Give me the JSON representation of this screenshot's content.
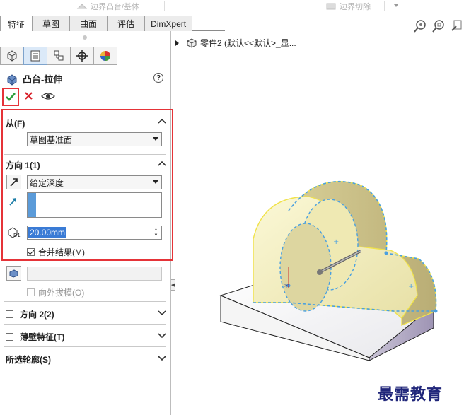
{
  "toolbar": {
    "boss_label": "边界凸台/基体",
    "cut_label": "边界切除"
  },
  "tabs": [
    "特征",
    "草图",
    "曲面",
    "评估",
    "DimXpert"
  ],
  "panel": {
    "icons": [
      "feature-manager-icon",
      "property-manager-icon",
      "configuration-manager-icon",
      "dimxpert-manager-icon",
      "display-manager-icon"
    ],
    "feature_title": "凸台-拉伸",
    "help_glyph": "?",
    "from": {
      "label": "从(F)",
      "value": "草图基准面"
    },
    "direction1": {
      "label": "方向 1(1)",
      "end_condition": "给定深度",
      "depth": "20.00mm",
      "merge_label": "合并结果(M)",
      "merge_checked": true,
      "draft_outward_label": "向外拔模(O)"
    },
    "direction2_label": "方向 2(2)",
    "thin_feature_label": "薄壁特征(T)",
    "selected_contours_label": "所选轮廓(S)"
  },
  "viewport": {
    "tree_label": "零件2  (默认<<默认>_显..."
  },
  "watermark": "最需教育",
  "colors": {
    "ok": "#2e9e3a",
    "cancel": "#d8212a",
    "highlight_box": "#e53338",
    "selection_blue": "#3a7bd5"
  }
}
